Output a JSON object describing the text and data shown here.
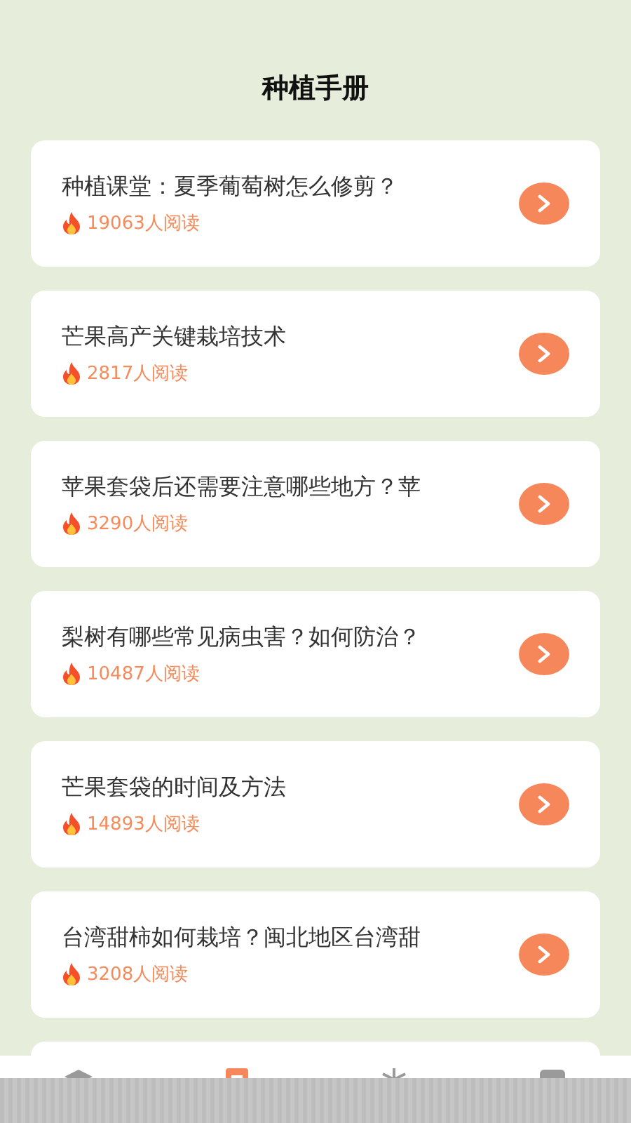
{
  "header": {
    "title": "种植手册"
  },
  "articles": [
    {
      "title": "种植课堂：夏季葡萄树怎么修剪？",
      "reads": "19063人阅读"
    },
    {
      "title": "芒果高产关键栽培技术",
      "reads": "2817人阅读"
    },
    {
      "title": "苹果套袋后还需要注意哪些地方？苹",
      "reads": "3290人阅读"
    },
    {
      "title": "梨树有哪些常见病虫害？如何防治？",
      "reads": "10487人阅读"
    },
    {
      "title": "芒果套袋的时间及方法",
      "reads": "14893人阅读"
    },
    {
      "title": "台湾甜柿如何栽培？闽北地区台湾甜",
      "reads": "3208人阅读"
    }
  ],
  "tab_bar": {
    "tabs": [
      {
        "selected": false
      },
      {
        "selected": true
      },
      {
        "selected": false
      },
      {
        "selected": false
      }
    ]
  }
}
